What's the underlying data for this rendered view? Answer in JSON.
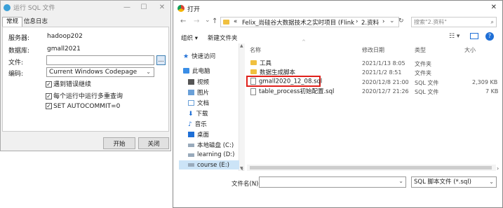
{
  "left_window": {
    "title": "运行 SQL 文件",
    "tabs": [
      "常规",
      "信息日志"
    ],
    "fields": {
      "server_label": "服务器:",
      "server_value": "hadoop202",
      "db_label": "数据库:",
      "db_value": "gmall2021",
      "file_label": "文件:",
      "file_value": "",
      "browse_label": "...",
      "encoding_label": "编码:",
      "encoding_value": "Current Windows Codepage"
    },
    "checkboxes": [
      "遇到错误继续",
      "每个运行中运行多重查询",
      "SET AUTOCOMMIT=0"
    ],
    "buttons": {
      "start": "开始",
      "close": "关闭"
    },
    "controls": {
      "minimize": "—",
      "maximize": "☐",
      "close": "✕"
    }
  },
  "right_window": {
    "title": "打开",
    "path": {
      "crumbs": [
        "«",
        "Felix_尚硅谷大数据技术之实时项目 (Flink...",
        "›",
        "2.资料",
        "›"
      ]
    },
    "search_placeholder": "搜索\"2.资料\"",
    "toolbar": {
      "organize": "组织 ▾",
      "new_folder": "新建文件夹"
    },
    "columns": [
      "名称",
      "修改日期",
      "类型",
      "大小"
    ],
    "nav": [
      {
        "label": "快速访问",
        "icon": "star-icon"
      },
      {
        "label": "此电脑",
        "icon": "computer-icon"
      },
      {
        "label": "视频",
        "icon": "video-icon"
      },
      {
        "label": "图片",
        "icon": "pictures-icon"
      },
      {
        "label": "文档",
        "icon": "document-icon"
      },
      {
        "label": "下载",
        "icon": "download-icon"
      },
      {
        "label": "音乐",
        "icon": "music-icon"
      },
      {
        "label": "桌面",
        "icon": "desktop-icon"
      },
      {
        "label": "本地磁盘 (C:)",
        "icon": "drive-icon"
      },
      {
        "label": "learning (D:)",
        "icon": "drive-icon"
      },
      {
        "label": "course (E:)",
        "icon": "drive-icon"
      }
    ],
    "files": [
      {
        "name": "工具",
        "date": "2021/1/13 8:05",
        "type": "文件夹",
        "size": "",
        "icon": "folder-icon"
      },
      {
        "name": "数据生成脚本",
        "date": "2021/1/2 8:51",
        "type": "文件夹",
        "size": "",
        "icon": "folder-icon"
      },
      {
        "name": "gmall2020_12_08.sql",
        "date": "2020/12/8 21:00",
        "type": "SQL 文件",
        "size": "2,309 KB",
        "icon": "file-icon"
      },
      {
        "name": "table_process初始配置.sql",
        "date": "2020/12/7 21:26",
        "type": "SQL 文件",
        "size": "7 KB",
        "icon": "file-icon"
      }
    ],
    "filename_label": "文件名(N):",
    "filename_value": "",
    "filetype_value": "SQL 脚本文件 (*.sql)",
    "close": "✕"
  }
}
